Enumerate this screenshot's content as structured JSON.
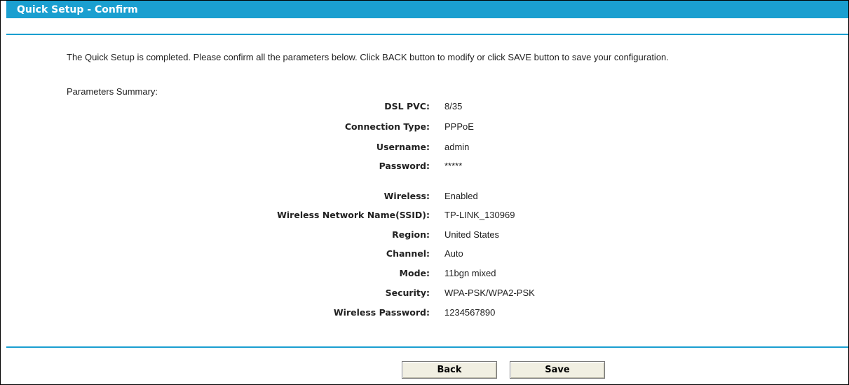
{
  "header": {
    "title": "Quick Setup - Confirm"
  },
  "intro_text": "The Quick Setup is completed. Please confirm all the parameters below. Click BACK button to modify or click SAVE button to save your configuration.",
  "summary_label": "Parameters Summary:",
  "params": [
    {
      "label": "DSL PVC:",
      "value": "8/35"
    },
    {
      "label": "Connection Type:",
      "value": "PPPoE"
    },
    {
      "label": "Username:",
      "value": "admin"
    },
    {
      "label": "Password:",
      "value": "*****"
    },
    {
      "label": "Wireless:",
      "value": "Enabled"
    },
    {
      "label": "Wireless Network Name(SSID):",
      "value": "TP-LINK_130969"
    },
    {
      "label": "Region:",
      "value": "United States"
    },
    {
      "label": "Channel:",
      "value": "Auto"
    },
    {
      "label": "Mode:",
      "value": "11bgn mixed"
    },
    {
      "label": "Security:",
      "value": "WPA-PSK/WPA2-PSK"
    },
    {
      "label": "Wireless Password:",
      "value": "1234567890"
    }
  ],
  "buttons": {
    "back": "Back",
    "save": "Save"
  },
  "colors": {
    "accent": "#1a9fd0",
    "button_bg": "#f1efe2"
  }
}
